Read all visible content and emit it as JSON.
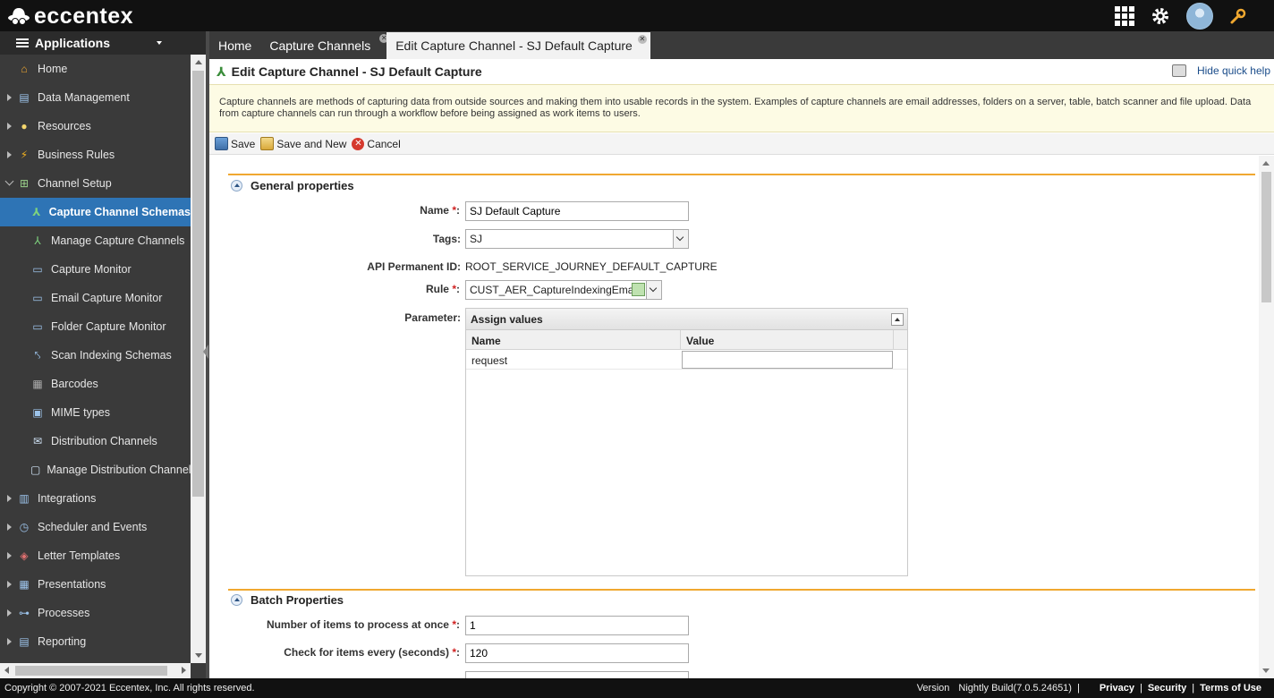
{
  "brand": {
    "name": "eccentex"
  },
  "sidebar": {
    "header": "Applications",
    "items": [
      {
        "label": "Home",
        "icon": "home-icon"
      },
      {
        "label": "Data Management",
        "icon": "data-icon"
      },
      {
        "label": "Resources",
        "icon": "lightbulb-icon"
      },
      {
        "label": "Business Rules",
        "icon": "lightning-icon"
      },
      {
        "label": "Channel Setup",
        "icon": "basket-icon"
      },
      {
        "label": "Capture Channel Schemas",
        "icon": "capture-icon"
      },
      {
        "label": "Manage Capture Channels",
        "icon": "capture-icon"
      },
      {
        "label": "Capture Monitor",
        "icon": "monitor-icon"
      },
      {
        "label": "Email Capture Monitor",
        "icon": "monitor-icon"
      },
      {
        "label": "Folder Capture Monitor",
        "icon": "monitor-icon"
      },
      {
        "label": "Scan Indexing Schemas",
        "icon": "scan-icon"
      },
      {
        "label": "Barcodes",
        "icon": "barcode-icon"
      },
      {
        "label": "MIME types",
        "icon": "mime-icon"
      },
      {
        "label": "Distribution Channels",
        "icon": "envelope-icon"
      },
      {
        "label": "Manage Distribution Channels",
        "icon": "chat-icon"
      },
      {
        "label": "Integrations",
        "icon": "integration-icon"
      },
      {
        "label": "Scheduler and Events",
        "icon": "scheduler-icon"
      },
      {
        "label": "Letter Templates",
        "icon": "letter-icon"
      },
      {
        "label": "Presentations",
        "icon": "presentation-icon"
      },
      {
        "label": "Processes",
        "icon": "process-icon"
      },
      {
        "label": "Reporting",
        "icon": "report-icon"
      }
    ]
  },
  "tabs": [
    {
      "label": "Home"
    },
    {
      "label": "Capture Channels"
    },
    {
      "label": "Edit Capture Channel - SJ Default Capture"
    }
  ],
  "page": {
    "title": "Edit Capture Channel - SJ Default Capture",
    "hide_help": "Hide quick help",
    "help_text": "Capture channels are methods of capturing data from outside sources and making them into usable records in the system. Examples of capture channels are email addresses, folders on a server, table, batch scanner and file upload. Data from capture channels can run through a workflow before being assigned as work items to users."
  },
  "toolbar": {
    "save": "Save",
    "save_new": "Save and New",
    "cancel": "Cancel"
  },
  "general": {
    "title": "General properties",
    "name_label": "Name",
    "name_value": "SJ Default Capture",
    "tags_label": "Tags:",
    "tags_value": "SJ",
    "api_label": "API Permanent ID:",
    "api_value": "ROOT_SERVICE_JOURNEY_DEFAULT_CAPTURE",
    "rule_label": "Rule",
    "rule_value": "CUST_AER_CaptureIndexingEmail",
    "param_label": "Parameter:",
    "param_panel_title": "Assign values",
    "param_columns": [
      "Name",
      "Value"
    ],
    "param_rows": [
      {
        "name": "request",
        "value": ""
      }
    ]
  },
  "batch": {
    "title": "Batch Properties",
    "items_label": "Number of items to process at once",
    "items_value": "1",
    "check_label": "Check for items every (seconds)",
    "check_value": "120"
  },
  "footer": {
    "copyright": "Copyright © 2007-2021 Eccentex, Inc. All rights reserved.",
    "version_label": "Version",
    "version_value": "Nightly Build(7.0.5.24651)",
    "links": [
      "Privacy",
      "Security",
      "Terms of Use"
    ]
  }
}
